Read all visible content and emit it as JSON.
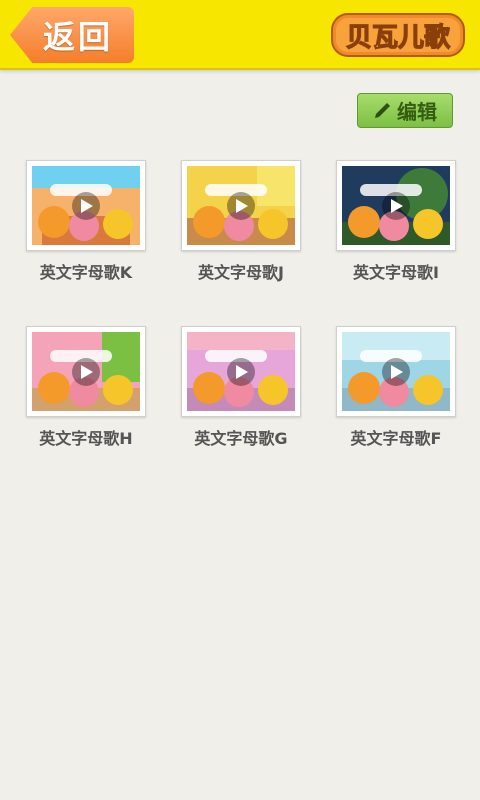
{
  "header": {
    "back_label": "返回",
    "logo_text": "贝瓦儿歌"
  },
  "toolbar": {
    "edit_label": "编辑"
  },
  "videos": [
    {
      "title": "英文字母歌K",
      "bg": "#f6b26b",
      "accent": "#6fd0f0"
    },
    {
      "title": "英文字母歌J",
      "bg": "#f4d24a",
      "accent": "#f08a2a"
    },
    {
      "title": "英文字母歌I",
      "bg": "#1f3b5e",
      "accent": "#3e7a3a"
    },
    {
      "title": "英文字母歌H",
      "bg": "#f5a3b8",
      "accent": "#7cc043"
    },
    {
      "title": "英文字母歌G",
      "bg": "#e7a6d9",
      "accent": "#f5b3c8"
    },
    {
      "title": "英文字母歌F",
      "bg": "#9fd6e6",
      "accent": "#c9ecf4"
    }
  ]
}
